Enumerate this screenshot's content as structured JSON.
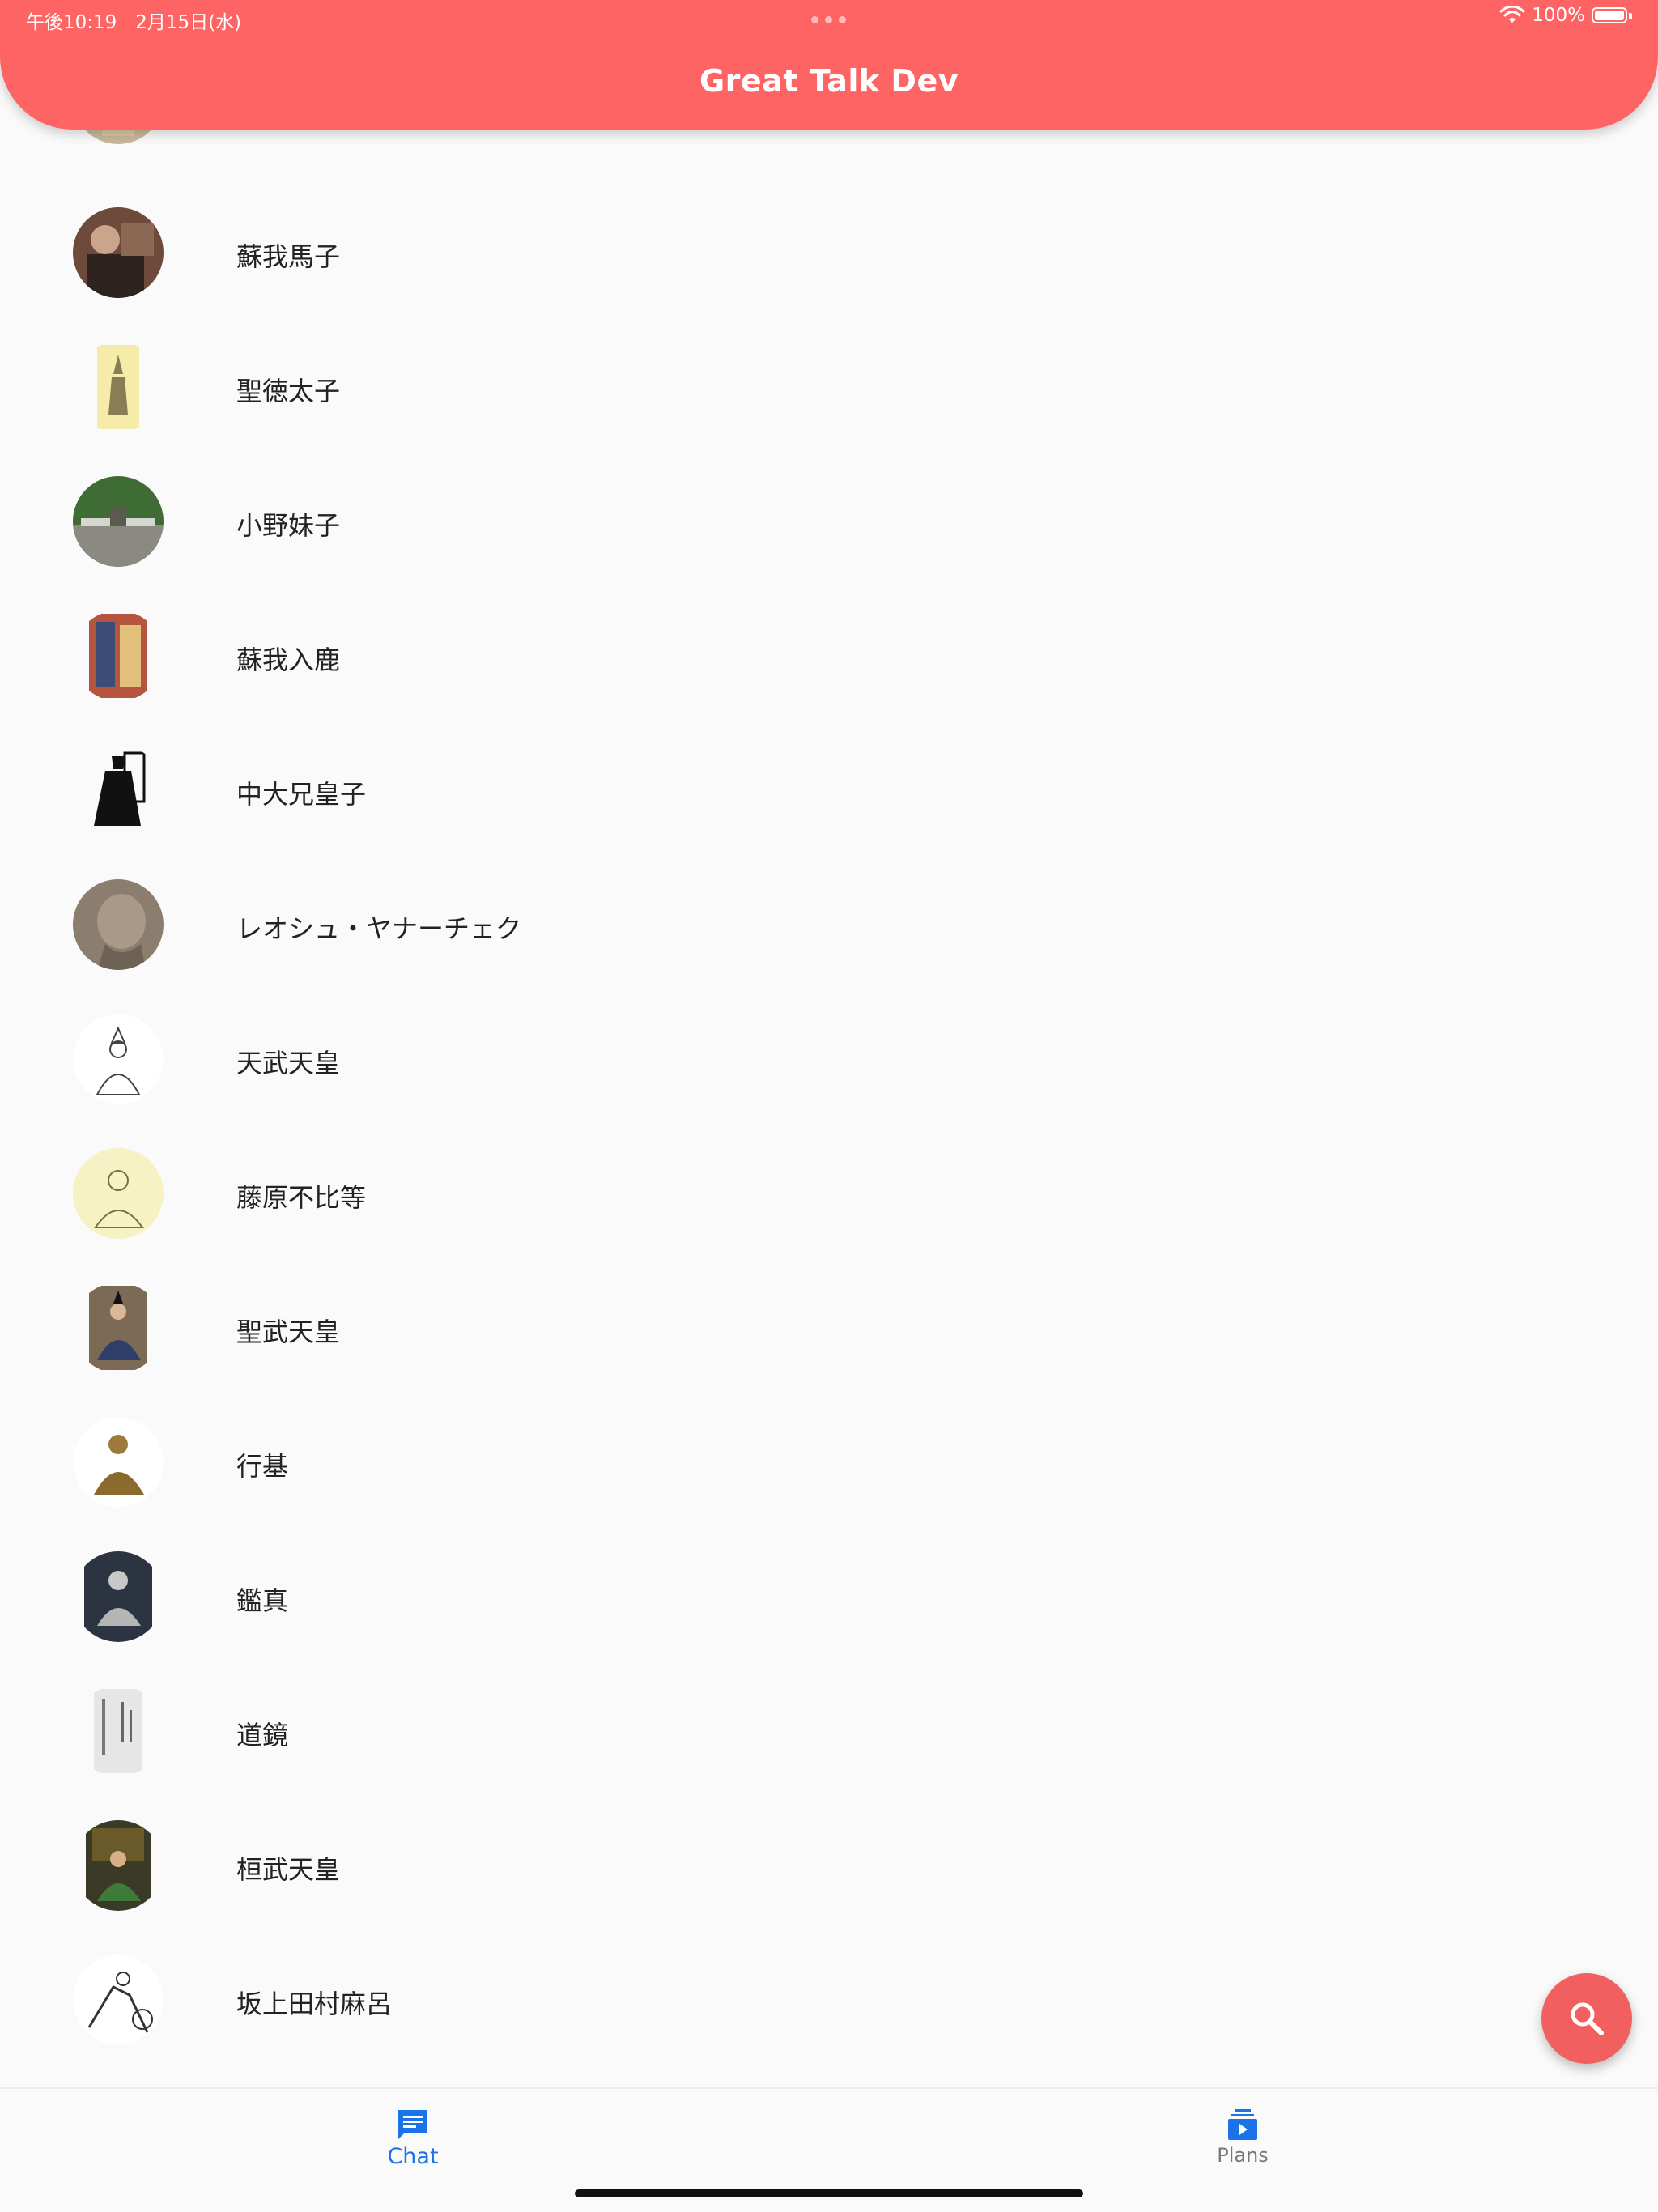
{
  "status_bar": {
    "time": "午後10:19　2月15日(水)",
    "battery": "100%"
  },
  "header": {
    "title": "Great Talk Dev"
  },
  "people": [
    {
      "name": ""
    },
    {
      "name": "蘇我馬子"
    },
    {
      "name": "聖徳太子"
    },
    {
      "name": "小野妹子"
    },
    {
      "name": "蘇我入鹿"
    },
    {
      "name": "中大兄皇子"
    },
    {
      "name": "レオシュ・ヤナーチェク"
    },
    {
      "name": "天武天皇"
    },
    {
      "name": "藤原不比等"
    },
    {
      "name": "聖武天皇"
    },
    {
      "name": "行基"
    },
    {
      "name": "鑑真"
    },
    {
      "name": "道鏡"
    },
    {
      "name": "桓武天皇"
    },
    {
      "name": "坂上田村麻呂"
    }
  ],
  "bottom_nav": {
    "chat_label": "Chat",
    "plans_label": "Plans"
  },
  "colors": {
    "header": "#ff6464",
    "fab": "#f25f5f",
    "nav_active": "#1a73e8"
  }
}
